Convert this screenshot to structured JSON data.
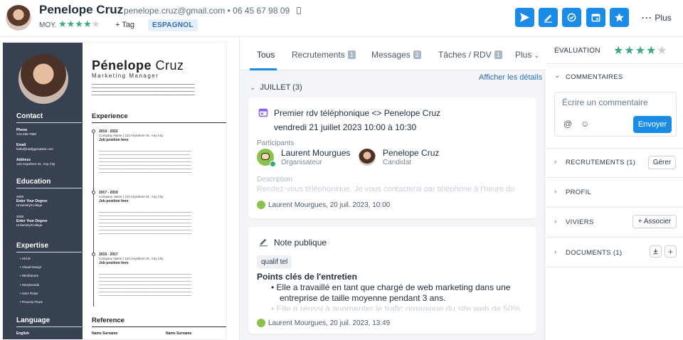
{
  "header": {
    "name": "Penelope Cruz",
    "email": "penelope.cruz@gmail.com",
    "phone": "06 45 67 98 09",
    "rating_label": "MOY.",
    "rating": 4,
    "tag_label": "+ Tag",
    "language_badge": "ESPAGNOL",
    "more_label": "Plus",
    "accent_color": "#1a8ce8"
  },
  "cv": {
    "first_name": "Pénelope",
    "last_name": "Cruz",
    "role": "Marketing Manager",
    "contact_title": "Contact",
    "phone_label": "Phone",
    "phone_value": "123-456-7890",
    "email_label": "Email",
    "email_value": "hello@reallygreatsite.com",
    "address_label": "Address",
    "address_value": "123 Anywhere St., Any City",
    "education_title": "Education",
    "edu": [
      {
        "year": "2008",
        "degree": "Enter Your Degree",
        "school": "University/College"
      },
      {
        "year": "2008",
        "degree": "Enter Your Degree",
        "school": "University/College"
      }
    ],
    "expertise_title": "Expertise",
    "expertise": [
      "UI/UX",
      "Visual Design",
      "Wireframes",
      "Storyboards",
      "User Flows",
      "Process Flows"
    ],
    "language_title": "Language",
    "language_item": "English",
    "experience_title": "Experience",
    "jobs": [
      {
        "years": "2019 - 2022",
        "company": "Company Name | 123 Anywhere St., Any City",
        "title": "Job position here"
      },
      {
        "years": "2017 - 2019",
        "company": "Company Name | 123 Anywhere St., Any City",
        "title": "Job position here"
      },
      {
        "years": "2015 - 2017",
        "company": "Company Name | 123 Anywhere St., Any City",
        "title": "Job position here"
      }
    ],
    "reference_title": "Reference",
    "ref1": "Name Surname",
    "ref2": "Name Surname"
  },
  "tabs": [
    {
      "label": "Tous"
    },
    {
      "label": "Recrutements",
      "count": "1"
    },
    {
      "label": "Messages",
      "count": "2"
    },
    {
      "label": "Tâches / RDV",
      "count": "1"
    },
    {
      "label": "Plus"
    }
  ],
  "feed": {
    "details_link": "Afficher les détails",
    "month": "JUILLET (3)",
    "event": {
      "title": "Premier rdv téléphonique <> Penelope Cruz",
      "datetime": "vendredi 21 juillet 2023 10:00 à 10:30",
      "participants_label": "Participants",
      "p1_name": "Laurent Mourgues",
      "p1_role": "Organisateur",
      "p2_name": "Penelope Cruz",
      "p2_role": "Candidat",
      "description_label": "Description",
      "description_text": "Rendez-vous téléphonique. Je vous contacterai par téléphone à l'heure du",
      "footer": "Laurent Mourgues, 20 juil. 2023, 10:00"
    },
    "note": {
      "title": "Note publique",
      "tag": "qualif tel",
      "heading": "Points clés de l'entretien",
      "bullet1a": "Elle a travaillé en tant que chargé de web marketing dans une",
      "bullet1b": "entreprise de taille moyenne pendant 3 ans.",
      "bullet2": "Elle a réussi à augmenter le trafic organique du site web de 50%",
      "footer": "Laurent Mourgues, 20 juil. 2023, 13:49"
    }
  },
  "panel": {
    "evaluation_label": "ÉVALUATION",
    "evaluation_rating": 4,
    "comments_label": "COMMENTAIRES",
    "comment_placeholder": "Écrire un commentaire",
    "send_label": "Envoyer",
    "recruitments_label": "RECRUTEMENTS (1)",
    "manage_label": "Gérer",
    "profile_label": "PROFIL",
    "pools_label": "VIVIERS",
    "associate_label": "+ Associer",
    "documents_label": "DOCUMENTS (1)"
  }
}
